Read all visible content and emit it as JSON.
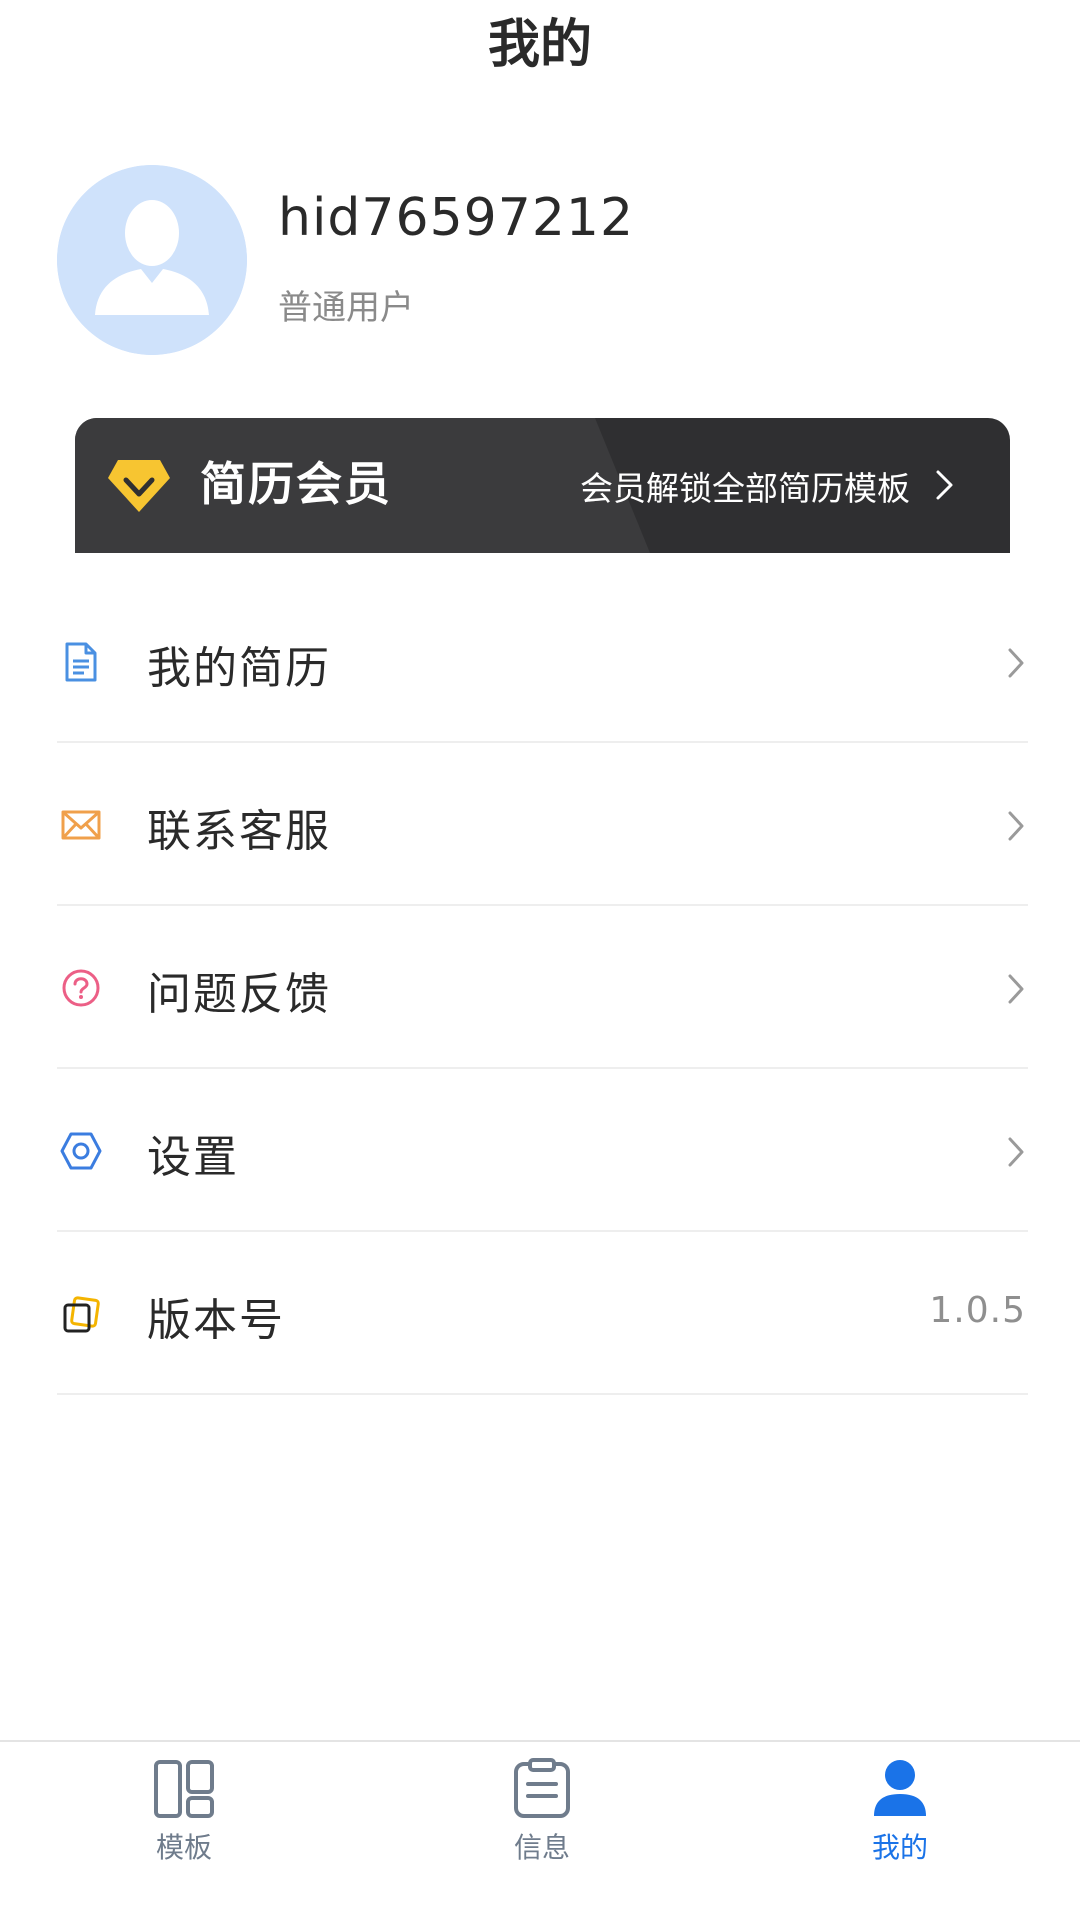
{
  "header": {
    "title": "我的"
  },
  "profile": {
    "username": "hid76597212",
    "user_type": "普通用户",
    "avatar_icon": "default-user-avatar-icon"
  },
  "vip_banner": {
    "title": "简历会员",
    "subtitle": "会员解锁全部简历模板",
    "icon": "vip-diamond-icon",
    "accent_color": "#f7c531",
    "background_color": "#2f2f31"
  },
  "menu": {
    "items": [
      {
        "label": "我的简历",
        "icon": "document-icon",
        "icon_color": "#4a90e2"
      },
      {
        "label": "联系客服",
        "icon": "envelope-icon",
        "icon_color": "#f0a04b"
      },
      {
        "label": "问题反馈",
        "icon": "question-circle-icon",
        "icon_color": "#ec5f86"
      },
      {
        "label": "设置",
        "icon": "settings-hexagon-icon",
        "icon_color": "#3b7de0"
      },
      {
        "label": "版本号",
        "icon": "version-cards-icon",
        "icon_color": "#f4b400",
        "value": "1.0.5"
      }
    ]
  },
  "tabbar": {
    "active_color": "#1a73e8",
    "inactive_color": "#6f7c8c",
    "tabs": [
      {
        "label": "模板",
        "icon": "grid-icon",
        "active": false
      },
      {
        "label": "信息",
        "icon": "clipboard-icon",
        "active": false
      },
      {
        "label": "我的",
        "icon": "person-icon",
        "active": true
      }
    ]
  }
}
